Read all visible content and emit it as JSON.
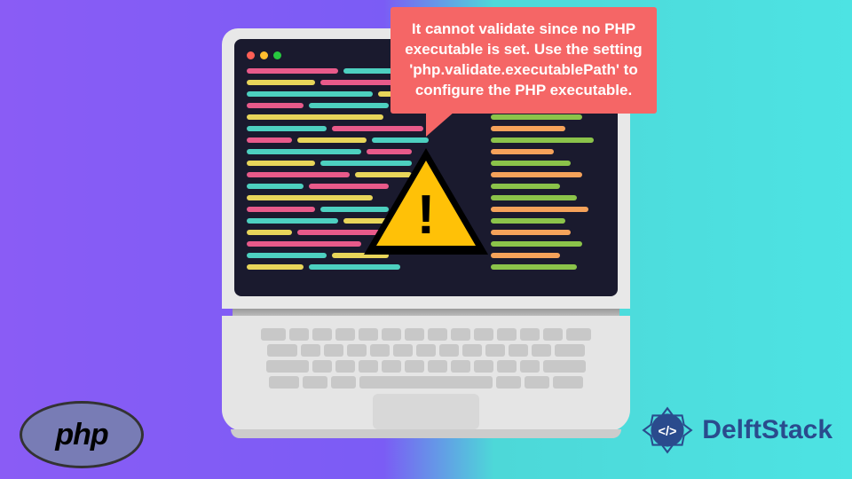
{
  "bubble_text": "It cannot validate since no PHP executable is set. Use the setting 'php.validate.executablePath' to configure the PHP executable.",
  "php_label": "php",
  "brand": "DelftStack",
  "colors": {
    "code": {
      "pink": "#e85a8a",
      "teal": "#4dd0c0",
      "yellow": "#e8d55a",
      "green": "#8bc34a",
      "orange": "#f5a25a"
    }
  }
}
